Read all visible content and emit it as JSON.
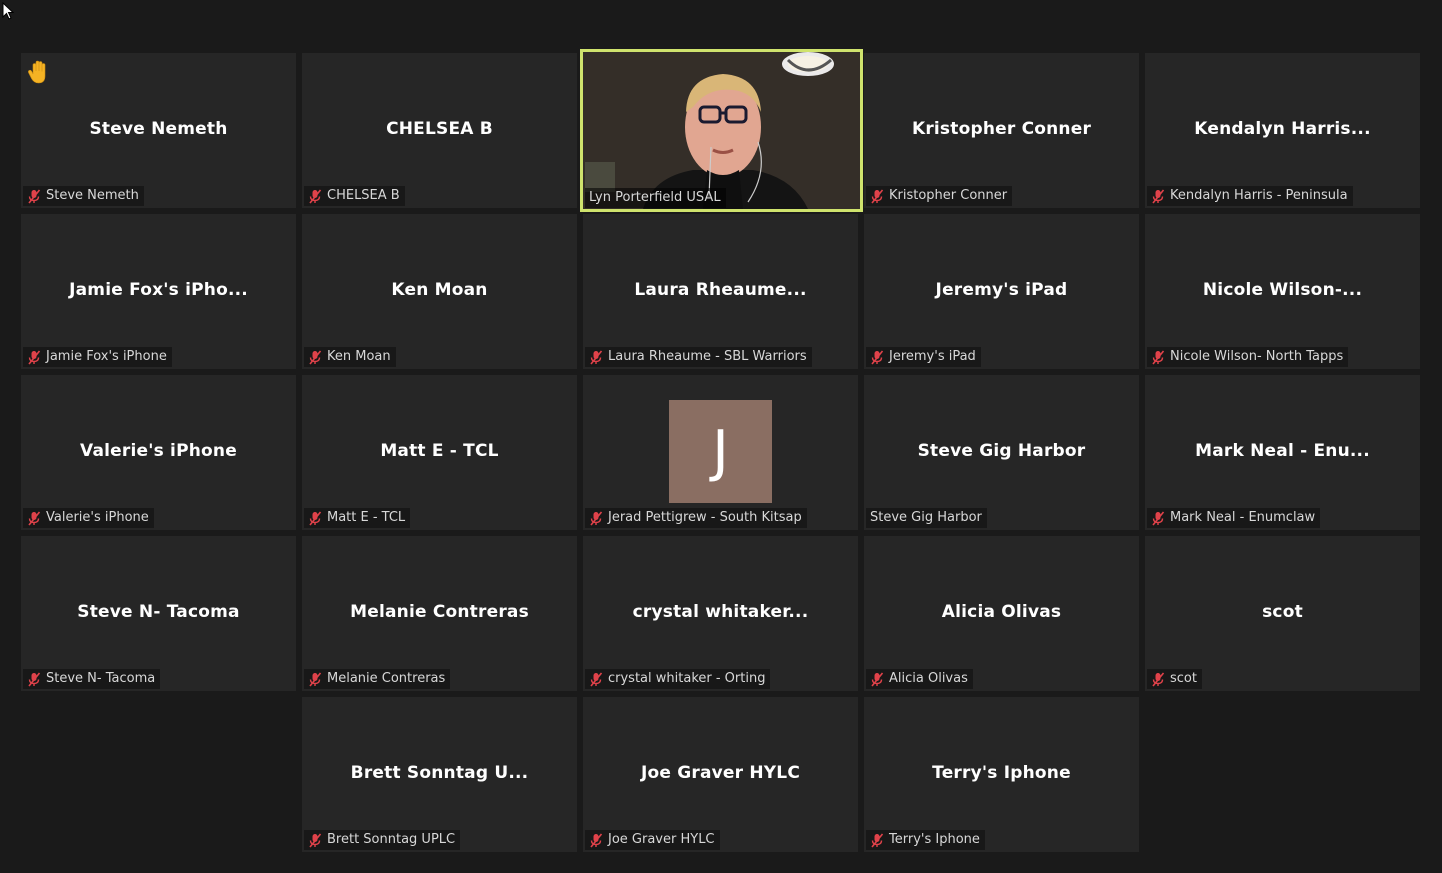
{
  "meeting": {
    "tiles": [
      {
        "display": "Steve Nemeth",
        "label": "Steve Nemeth",
        "muted": true,
        "hand_raised": true
      },
      {
        "display": "CHELSEA B",
        "label": "CHELSEA B",
        "muted": true
      },
      {
        "display": "",
        "label": "Lyn Porterfield  USAL",
        "muted": false,
        "video": true,
        "active_speaker": true
      },
      {
        "display": "Kristopher Conner",
        "label": "Kristopher Conner",
        "muted": true
      },
      {
        "display": "Kendalyn  Harris...",
        "label": "Kendalyn Harris - Peninsula",
        "muted": true
      },
      {
        "display": "Jamie  Fox's  iPho...",
        "label": "Jamie Fox's iPhone",
        "muted": true
      },
      {
        "display": "Ken Moan",
        "label": "Ken Moan",
        "muted": true
      },
      {
        "display": "Laura  Rheaume...",
        "label": "Laura Rheaume - SBL Warriors",
        "muted": true
      },
      {
        "display": "Jeremy's iPad",
        "label": "Jeremy's iPad",
        "muted": true
      },
      {
        "display": "Nicole  Wilson-...",
        "label": "Nicole Wilson- North Tapps",
        "muted": true
      },
      {
        "display": "Valerie's iPhone",
        "label": "Valerie's iPhone",
        "muted": true
      },
      {
        "display": "Matt E - TCL",
        "label": "Matt E - TCL",
        "muted": true
      },
      {
        "display": "",
        "label": "Jerad Pettigrew - South Kitsap",
        "muted": true,
        "avatar_letter": "J",
        "avatar_color": "#8a6e62"
      },
      {
        "display": "Steve Gig Harbor",
        "label": "Steve Gig Harbor",
        "muted": false
      },
      {
        "display": "Mark Neal  -  Enu...",
        "label": "Mark Neal - Enumclaw",
        "muted": true
      },
      {
        "display": "Steve N- Tacoma",
        "label": "Steve N- Tacoma",
        "muted": true
      },
      {
        "display": "Melanie Contreras",
        "label": "Melanie Contreras",
        "muted": true
      },
      {
        "display": "crystal  whitaker...",
        "label": "crystal whitaker - Orting",
        "muted": true
      },
      {
        "display": "Alicia Olivas",
        "label": "Alicia Olivas",
        "muted": true
      },
      {
        "display": "scot",
        "label": "scot",
        "muted": true
      },
      {
        "display": "Brett  Sonntag  U...",
        "label": "Brett Sonntag UPLC",
        "muted": true
      },
      {
        "display": "Joe Graver HYLC",
        "label": "Joe Graver HYLC",
        "muted": true
      },
      {
        "display": "Terry's Iphone",
        "label": "Terry's Iphone",
        "muted": true
      }
    ],
    "colors": {
      "background": "#1a1a1a",
      "tile": "#262626",
      "active_border": "#cfe36d",
      "mute_icon": "#e0424a",
      "hand_icon": "#f5b324"
    }
  }
}
